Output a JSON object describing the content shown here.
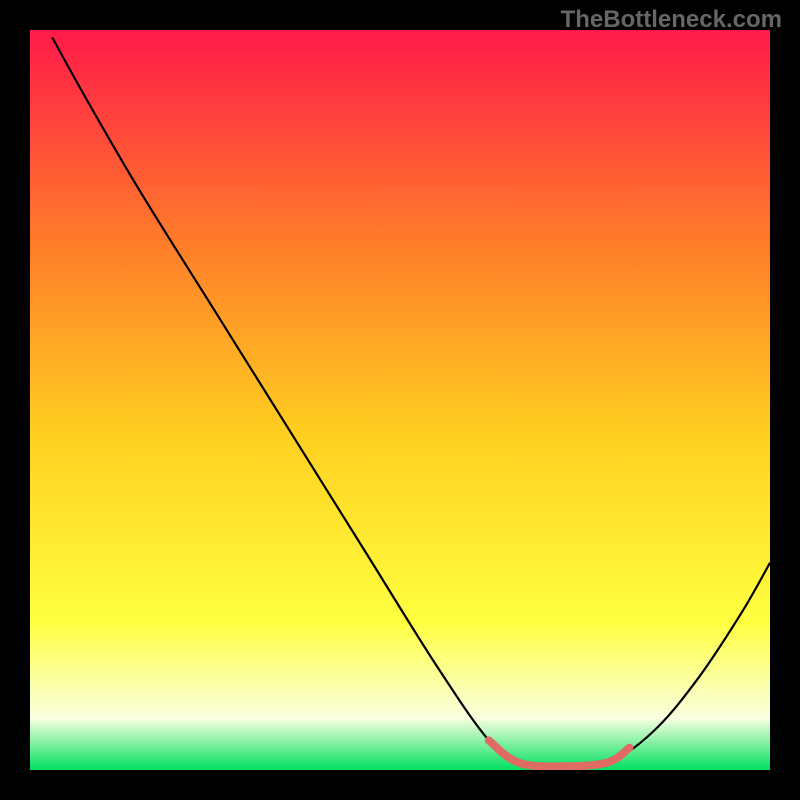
{
  "watermark": "TheBottleneck.com",
  "chart_data": {
    "type": "line",
    "title": "",
    "xlabel": "",
    "ylabel": "",
    "xlim": [
      0,
      100
    ],
    "ylim": [
      0,
      100
    ],
    "background_gradient": {
      "top": "#ff1a4a",
      "upper_mid": "#ff7a2a",
      "mid": "#ffd020",
      "lower_mid": "#ffff40",
      "near_bottom": "#faffe0",
      "bottom": "#00e060"
    },
    "series": [
      {
        "name": "curve",
        "color": "#000000",
        "points": [
          {
            "x": 3,
            "y": 99
          },
          {
            "x": 8,
            "y": 90
          },
          {
            "x": 15,
            "y": 78
          },
          {
            "x": 25,
            "y": 62
          },
          {
            "x": 35,
            "y": 46
          },
          {
            "x": 45,
            "y": 30
          },
          {
            "x": 55,
            "y": 14
          },
          {
            "x": 62,
            "y": 4
          },
          {
            "x": 66,
            "y": 1
          },
          {
            "x": 72,
            "y": 0.5
          },
          {
            "x": 78,
            "y": 1
          },
          {
            "x": 84,
            "y": 5
          },
          {
            "x": 90,
            "y": 12
          },
          {
            "x": 96,
            "y": 21
          },
          {
            "x": 100,
            "y": 28
          }
        ]
      },
      {
        "name": "highlight-segment",
        "color": "#e06a64",
        "points": [
          {
            "x": 62,
            "y": 4
          },
          {
            "x": 66,
            "y": 1
          },
          {
            "x": 72,
            "y": 0.5
          },
          {
            "x": 78,
            "y": 1
          },
          {
            "x": 81,
            "y": 3
          }
        ]
      }
    ]
  }
}
